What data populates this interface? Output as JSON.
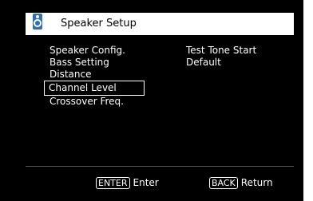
{
  "header": {
    "title": "Speaker Setup",
    "icon": "speaker-icon",
    "icon_color": "#2e6fb7"
  },
  "menu": {
    "items": [
      {
        "label": "Speaker Config."
      },
      {
        "label": "Bass Setting"
      },
      {
        "label": "Distance"
      },
      {
        "label": "Channel Level",
        "selected": true
      },
      {
        "label": "Crossover Freq."
      }
    ]
  },
  "right": {
    "items": [
      {
        "label": "Test Tone Start"
      },
      {
        "label": "Default"
      }
    ]
  },
  "footer": {
    "enter_key": "ENTER",
    "enter_label": "Enter",
    "back_key": "BACK",
    "back_label": "Return"
  }
}
